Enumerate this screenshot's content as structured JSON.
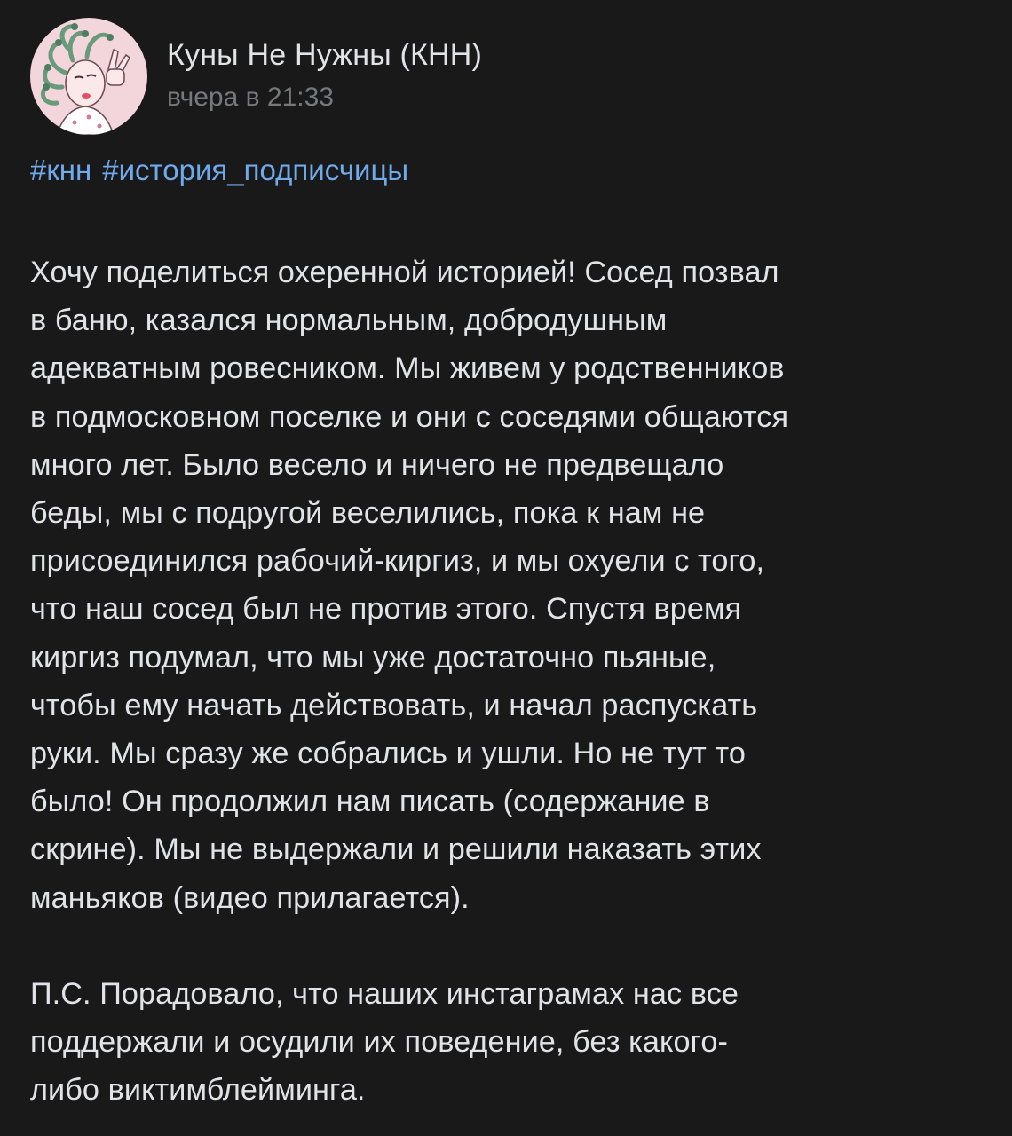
{
  "post": {
    "author": "Куны Не Нужны (КНН)",
    "time": "вчера в 21:33",
    "avatar_icon": "medusa-girl-avatar-icon",
    "hashtags": [
      "#кнн",
      "#история_подписчицы"
    ],
    "paragraphs": [
      [
        "Хочу поделиться охеренной историей! Сосед позвал",
        "в баню, казался нормальным, добродушным",
        "адекватным ровесником. Мы живем у родственников",
        "в подмосковном поселке и они с соседями общаются",
        "много лет. Было весело и ничего не предвещало",
        "беды, мы с подругой веселились, пока к нам не",
        "присоединился рабочий-киргиз, и мы охуели с того,",
        "что наш сосед был не против этого. Спустя время",
        "киргиз подумал, что мы уже достаточно пьяные,",
        "чтобы ему начать действовать, и начал распускать",
        "руки. Мы сразу же собрались и ушли. Но не тут то",
        "было! Он продолжил нам писать (содержание в",
        "скрине). Мы не выдержали и решили наказать этих",
        "маньяков (видео прилагается)."
      ],
      [
        "П.С. Порадовало, что наших инстаграмах нас все",
        "поддержали и осудили их поведение, без какого-",
        "либо виктимблейминга."
      ]
    ]
  },
  "colors": {
    "background": "#19191a",
    "text": "#e1e3e6",
    "secondary": "#76787a",
    "link": "#71aaeb",
    "avatar_bg": "#f3d6dc"
  }
}
